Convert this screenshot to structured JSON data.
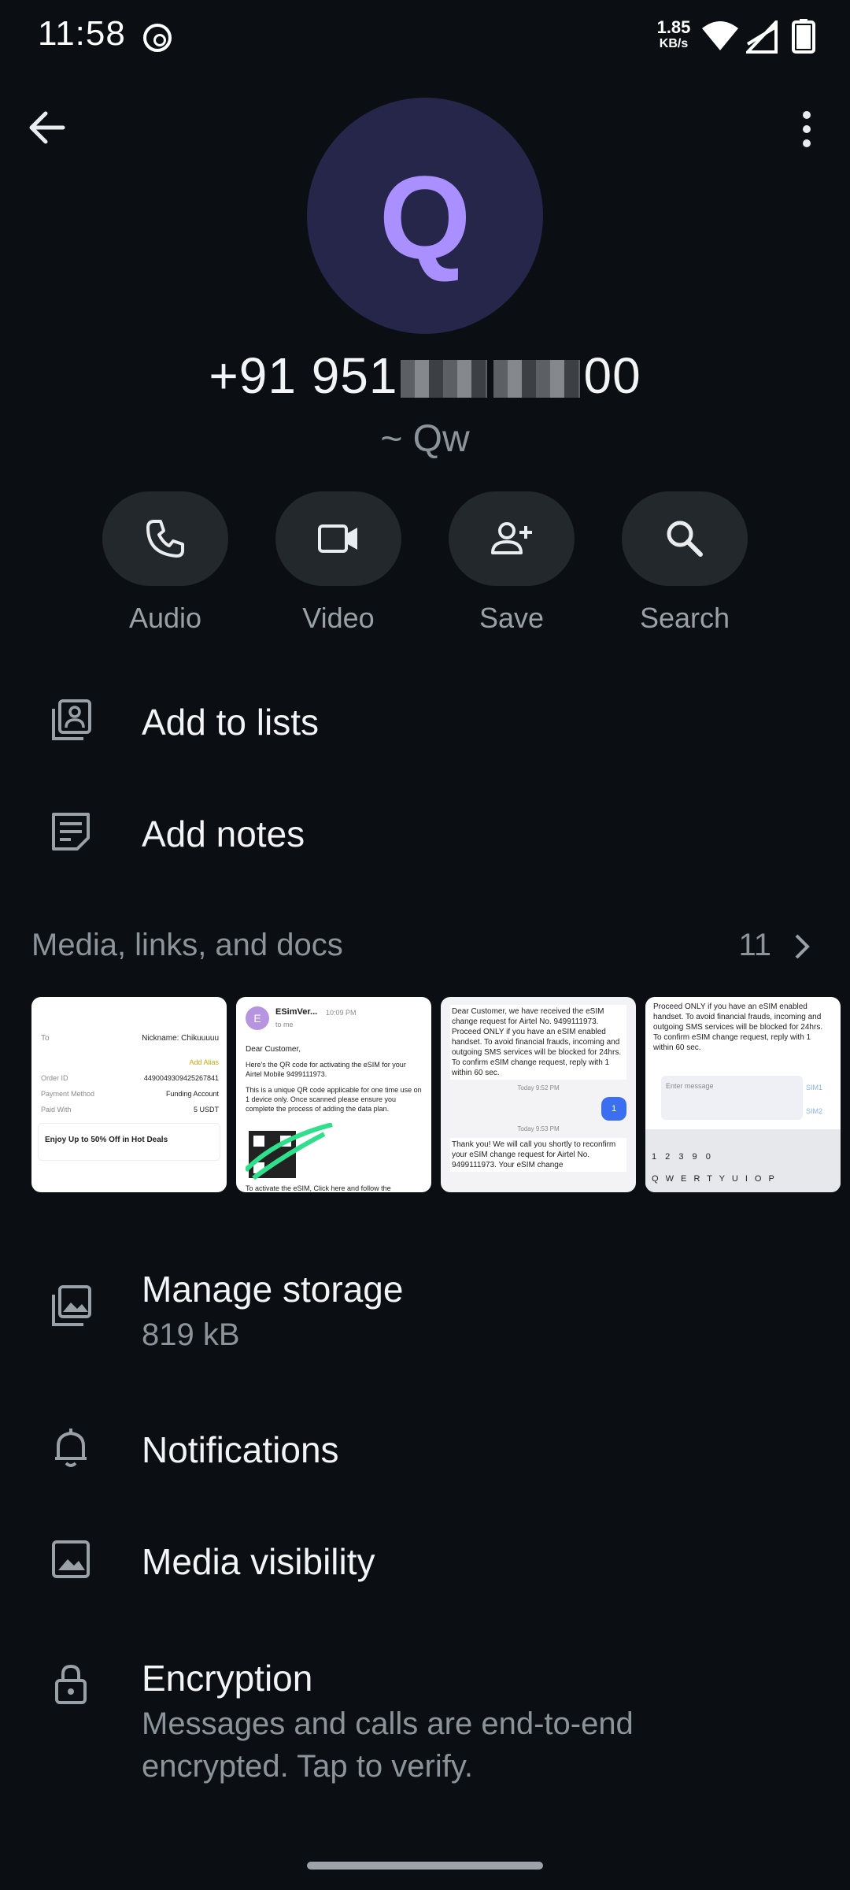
{
  "status_bar": {
    "time": "11:58",
    "speed_value": "1.85",
    "speed_unit": "KB/s"
  },
  "contact": {
    "avatar_letter": "Q",
    "phone_prefix": "+91 951",
    "phone_suffix": "00",
    "push_name": "~ Qw",
    "avatar_bg": "#25264a",
    "avatar_fg": "#a98fff"
  },
  "actions": [
    {
      "label": "Audio",
      "icon": "phone-icon"
    },
    {
      "label": "Video",
      "icon": "video-icon"
    },
    {
      "label": "Save",
      "icon": "add-person-icon"
    },
    {
      "label": "Search",
      "icon": "search-icon"
    }
  ],
  "rows": {
    "add_to_lists": "Add to lists",
    "add_notes": "Add notes",
    "manage_storage": "Manage storage",
    "storage_size": "819 kB",
    "notifications": "Notifications",
    "media_visibility": "Media visibility",
    "encryption": "Encryption",
    "encryption_sub": "Messages and calls are end-to-end encrypted. Tap to verify."
  },
  "media": {
    "title": "Media, links, and docs",
    "count": "11",
    "thumb1": {
      "to_label": "To",
      "to_value": "Nickname: Chikuuuuu",
      "add_alias": "Add Alias",
      "order_label": "Order ID",
      "order_value": "4490049309425267841",
      "method_label": "Payment Method",
      "method_value": "Funding Account",
      "paid_label": "Paid With",
      "paid_value": "5 USDT",
      "promo": "Enjoy Up to 50% Off in Hot Deals"
    },
    "thumb2": {
      "sender": "ESimVer...",
      "time": "10:09 PM",
      "to_me": "to me",
      "greeting": "Dear Customer,",
      "body1": "Here's the QR code for activating the eSIM for your Airtel Mobile 9499111973.",
      "body2": "This is a unique QR code applicable for one time use on 1 device only. Once scanned please ensure you complete the process of adding the data plan.",
      "footer": "To activate the eSIM, Click here and follow the"
    },
    "thumb3": {
      "msg1": "Dear Customer, we have received the eSIM change request for Airtel No. 9499111973. Proceed ONLY if you have an eSIM enabled handset. To avoid financial frauds, incoming and outgoing SMS services will be blocked for 24hrs. To confirm eSIM change request, reply with 1 within 60 sec.",
      "time1": "Today 9:52 PM",
      "reply": "1",
      "time2": "Today 9:53 PM",
      "msg2": "Thank you! We will call you shortly to reconfirm your eSIM change request for Airtel No. 9499111973. Your eSIM change"
    },
    "thumb4": {
      "msg": "Proceed ONLY if you have an eSIM enabled handset. To avoid financial frauds, incoming and outgoing SMS services will be blocked for 24hrs. To confirm eSIM change request, reply with 1 within 60 sec.",
      "placeholder": "Enter message",
      "sim1": "SIM1",
      "sim2": "SIM2",
      "keys": "1 2 3 9 0",
      "letters": "Q W E R T Y U I O P"
    }
  }
}
